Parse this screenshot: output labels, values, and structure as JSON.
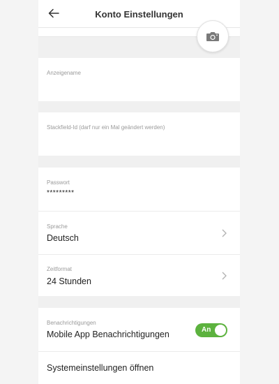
{
  "header": {
    "title": "Konto Einstellungen",
    "back_icon": "arrow-left-icon"
  },
  "profile": {
    "camera_icon": "camera-icon"
  },
  "fields": {
    "display_name": {
      "label": "Anzeigename",
      "value": ""
    },
    "stackfield_id": {
      "label": "Stackfield-Id (darf nur ein Mal geändert werden)",
      "value": ""
    },
    "password": {
      "label": "Passwort",
      "value": "*********"
    },
    "language": {
      "label": "Sprache",
      "value": "Deutsch"
    },
    "time_format": {
      "label": "Zeitformat",
      "value": "24 Stunden"
    }
  },
  "notifications": {
    "label": "Benachrichtigungen",
    "value": "Mobile App Benachrichtigungen",
    "toggle_label": "An",
    "enabled": true
  },
  "system_settings": {
    "label": "Systemeinstellungen öffnen"
  },
  "colors": {
    "toggle_on": "#5cb23e",
    "background": "#f0f0f0",
    "card": "#ffffff"
  }
}
